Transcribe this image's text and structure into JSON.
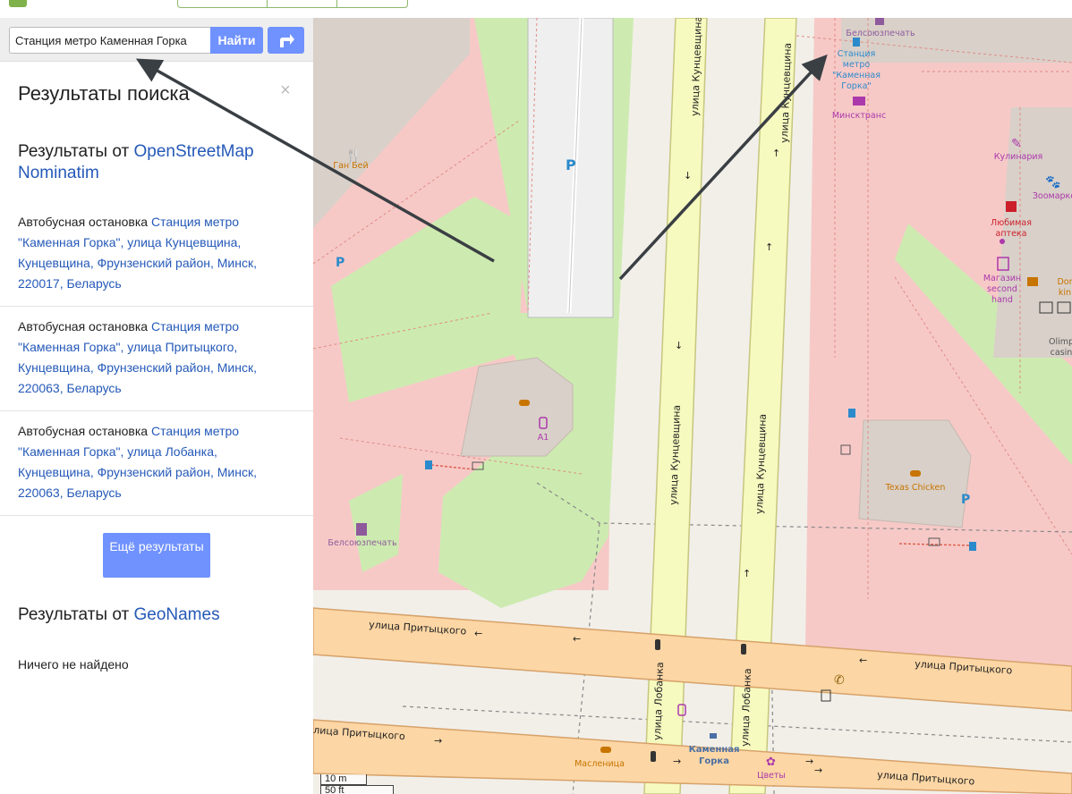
{
  "search": {
    "value": "Станция метро Каменная Горка",
    "button_label": "Найти"
  },
  "sidebar": {
    "title": "Результаты поиска",
    "close": "×",
    "osm_heading_prefix": "Результаты от ",
    "osm_heading_link": "OpenStreetMap Nominatim",
    "results": [
      {
        "type": "Автобусная остановка",
        "link": "Станция метро \"Каменная Горка\", улица Кунцевщина, Кунцевщина, Фрунзенский район, Минск, 220017, Беларусь"
      },
      {
        "type": "Автобусная остановка",
        "link": "Станция метро \"Каменная Горка\", улица Притыцкого, Кунцевщина, Фрунзенский район, Минск, 220063, Беларусь"
      },
      {
        "type": "Автобусная остановка",
        "link": "Станция метро \"Каменная Горка\", улица Лобанка, Кунцевщина, Фрунзенский район, Минск, 220063, Беларусь"
      }
    ],
    "more_button": "Ещё результаты",
    "geonames_heading_prefix": "Результаты от ",
    "geonames_heading_link": "GeoNames",
    "geonames_empty": "Ничего не найдено"
  },
  "map": {
    "labels": {
      "belsoyuz_top": "Белсоюзпечать",
      "station_1": "Станция",
      "station_2": "метро",
      "station_3": "\"Каменная",
      "station_4": "Горка\"",
      "minsktrans": "Минсктранс",
      "gan_bei": "Ган Бей",
      "parking": "P",
      "a1": "А1",
      "belsoyuz_bottom": "Белсоюзпечать",
      "kulinaria": "Кулинария",
      "zoomarket": "Зоомарке",
      "apteka_1": "Любимая",
      "apteka_2": "аптека",
      "magazin_1": "Магазин",
      "magazin_2": "second",
      "magazin_3": "hand",
      "dor_1": "Dor",
      "dor_2": "kin",
      "olimp_1": "Olimp",
      "olimp_2": "casin",
      "texas": "Texas Chicken",
      "kamennaya_1": "Каменная",
      "kamennaya_2": "Горка",
      "maslenitsa": "Масленица",
      "tsvety": "Цветы",
      "kuntsevshchina_a": "улица Кунцевщина",
      "kuntsevshchina_b": "улица Кунцевщина",
      "kuntsevshchina_c": "улица Кунцевщина",
      "kuntsevshchina_d": "улица Кунцевщина",
      "kuntsevshchina_e": "улица Кунцевщина",
      "prityckogo_a": "улица Притыцкого",
      "prityckogo_b": "улица Притыцкого",
      "prityckogo_c": "лица Притыцкого",
      "prityckogo_d": "улица Притыцкого",
      "lobanka_a": "улица Лобанка",
      "lobanka_b": "улица Лобанка"
    },
    "scale": {
      "primary": "10 m",
      "secondary": "50 ft"
    },
    "colors": {
      "residential": "#f6c9c7",
      "grass": "#cdebb0",
      "road_main": "#f7fabf",
      "road_secondary": "#fcd6a4",
      "building": "#d9d0c9",
      "link": "#2559b8",
      "button": "#7092ff",
      "amenity": "#ac39ac"
    }
  }
}
